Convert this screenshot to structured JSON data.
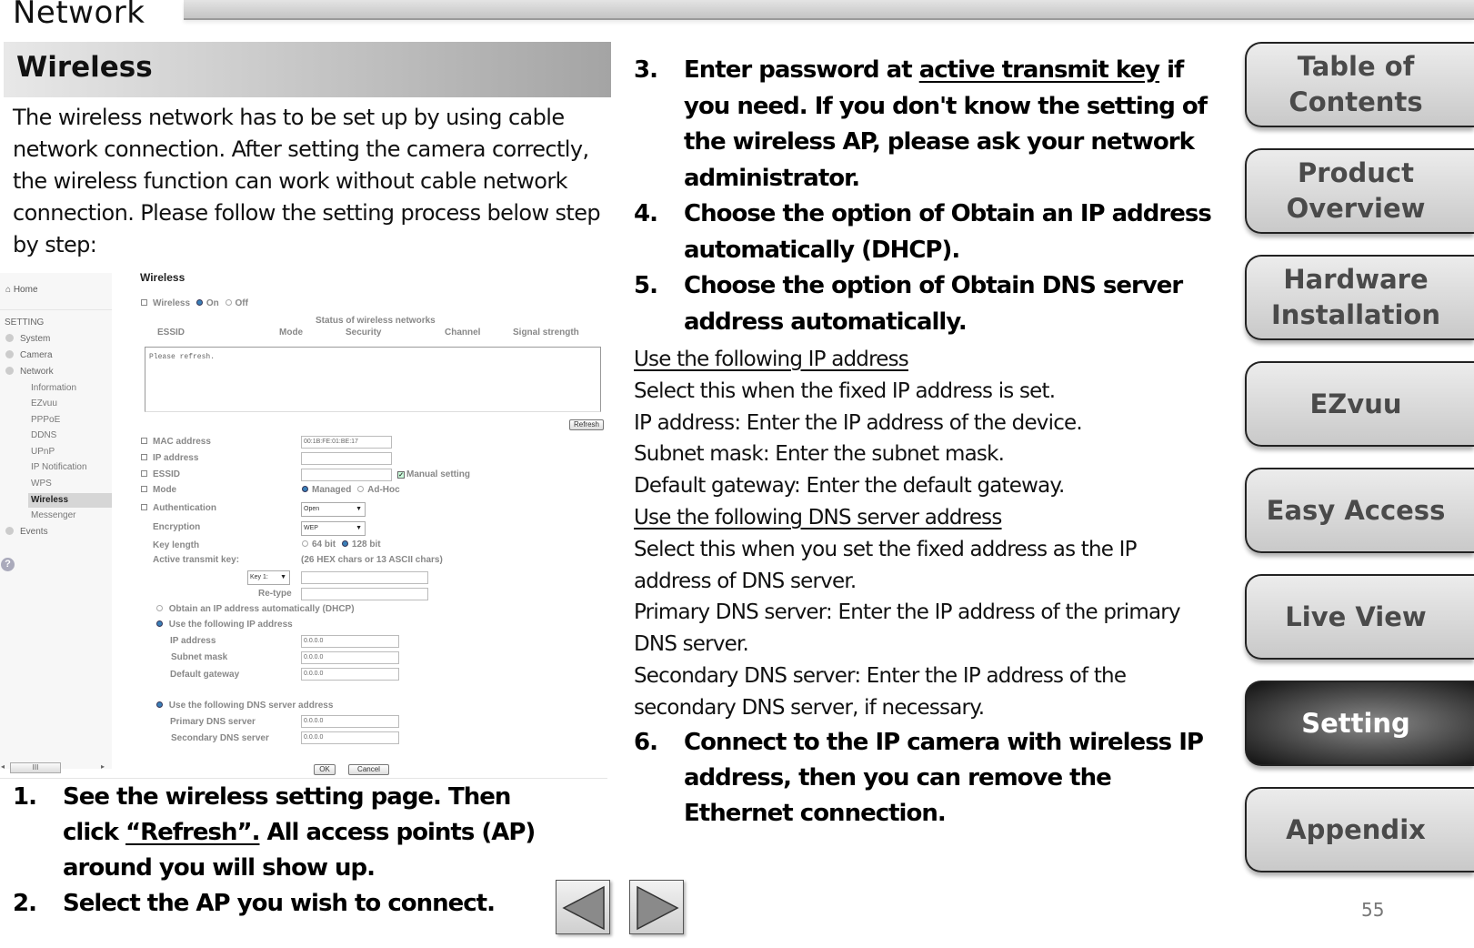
{
  "header": {
    "title": "Network"
  },
  "section": {
    "title": "Wireless"
  },
  "intro": "The wireless network has to be set up by using cable network connection. After setting the camera correctly, the wireless function can work without cable network connection. Please follow the setting process below step by step:",
  "screenshot": {
    "sidebar": {
      "home": "Home",
      "setting_label": "SETTING",
      "items": [
        "System",
        "Camera",
        "Network",
        "Events"
      ],
      "network_sub": [
        "Information",
        "EZvuu",
        "PPPoE",
        "DDNS",
        "UPnP",
        "IP Notification",
        "WPS",
        "Wireless",
        "Messenger"
      ],
      "active": "Wireless",
      "scroll_thumb": "III"
    },
    "title": "Wireless",
    "wireless_label": "Wireless",
    "on_label": "On",
    "off_label": "Off",
    "status_title": "Status of wireless networks",
    "columns": [
      "ESSID",
      "Mode",
      "Security",
      "Channel",
      "Signal strength"
    ],
    "list_placeholder": "Please refresh.",
    "refresh_button": "Refresh",
    "fields": {
      "mac_label": "MAC address",
      "mac_value": "00:1B:FE:01:BE:17",
      "ip_label": "IP address",
      "essid_label": "ESSID",
      "manual_setting": "Manual setting",
      "mode_label": "Mode",
      "mode_managed": "Managed",
      "mode_adhoc": "Ad-Hoc",
      "auth_label": "Authentication",
      "auth_value": "Open",
      "enc_label": "Encryption",
      "enc_value": "WEP",
      "keylen_label": "Key length",
      "key64": "64 bit",
      "key128": "128 bit",
      "active_key_label": "Active transmit key:",
      "active_key_hint": "(26 HEX chars or 13 ASCII chars)",
      "key_select": "Key 1:",
      "retype_label": "Re-type",
      "dhcp_option": "Obtain an IP address automatically (DHCP)",
      "static_option": "Use the following IP address",
      "ip_address_label": "IP address",
      "ip_address_value": "0.0.0.0",
      "subnet_label": "Subnet mask",
      "subnet_value": "0.0.0.0",
      "gateway_label": "Default gateway",
      "gateway_value": "0.0.0.0",
      "dns_option": "Use the following DNS server address",
      "primary_dns_label": "Primary DNS server",
      "primary_dns_value": "0.0.0.0",
      "secondary_dns_label": "Secondary DNS server",
      "secondary_dns_value": "0.0.0.0"
    },
    "ok_button": "OK",
    "cancel_button": "Cancel"
  },
  "steps_left": [
    {
      "num": "1.",
      "pre": "See the wireless setting page. Then click ",
      "link": "“Refresh”.",
      "post": " All access points (AP) around you will show up."
    },
    {
      "num": "2.",
      "text": "Select the AP you wish to connect."
    }
  ],
  "steps_right": [
    {
      "num": "3.",
      "pre": "Enter password at ",
      "link": "active transmit key",
      "post": " if you need. If you don't know the setting of the wireless AP, please ask your network administrator."
    },
    {
      "num": "4.",
      "text": "Choose the option of Obtain an IP address automatically (DHCP)."
    },
    {
      "num": "5.",
      "text": "Choose the option of Obtain DNS server address automatically."
    }
  ],
  "notes": {
    "ip_heading": "Use the following IP address",
    "ip_lines": [
      "Select this when the fixed IP address is set.",
      "IP address: Enter the IP address of the device.",
      "Subnet mask: Enter the subnet mask.",
      "Default gateway: Enter the default gateway."
    ],
    "dns_heading": "Use the following DNS server address",
    "dns_lines": [
      "Select this when you set the fixed address as the IP address of DNS server.",
      "Primary DNS server: Enter the IP address of the primary DNS server.",
      "Secondary DNS server: Enter the IP address of the secondary DNS server, if necessary."
    ]
  },
  "step6": {
    "num": "6.",
    "text": "Connect to the IP camera with wireless IP address, then you can remove the Ethernet connection."
  },
  "nav": {
    "items": [
      "Table of Contents",
      "Product Overview",
      "Hardware Installation",
      "EZvuu",
      "Easy Access",
      "Live View",
      "Setting",
      "Appendix"
    ],
    "active": "Setting",
    "prev_icon": "left-triangle",
    "next_icon": "right-triangle"
  },
  "page_number": "55"
}
